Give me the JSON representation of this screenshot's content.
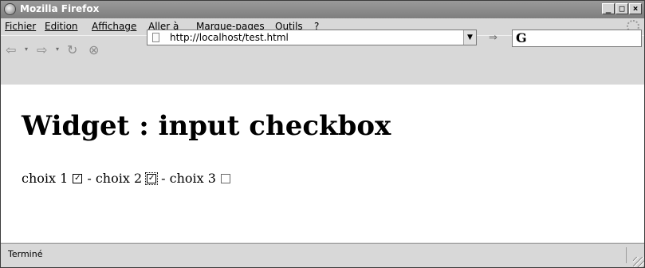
{
  "window": {
    "title": "Mozilla Firefox",
    "controls": [
      "_",
      "□",
      "×"
    ]
  },
  "menubar": {
    "items": [
      {
        "label": "Fichier"
      },
      {
        "label": "Edition"
      },
      {
        "label": "Affichage"
      },
      {
        "label": "Aller à"
      },
      {
        "label": "Marque-pages"
      },
      {
        "label": "Outils"
      },
      {
        "label": "?"
      }
    ]
  },
  "toolbar": {
    "back": "⇦",
    "forward": "⇨",
    "reload": "↻",
    "stop": "⊗",
    "dropdown": "▾",
    "go": "⇒"
  },
  "urlbar": {
    "value": "http://localhost/test.html",
    "dropdown": "▼"
  },
  "searchbar": {
    "engine_glyph": "G",
    "value": ""
  },
  "page": {
    "heading": "Widget : input checkbox",
    "choices": [
      {
        "label": "choix 1",
        "checked": true
      },
      {
        "separator": "-",
        "label": "choix 2",
        "checked": true,
        "focused": true
      },
      {
        "separator": "-",
        "label": "choix 3",
        "checked": false
      }
    ]
  },
  "statusbar": {
    "text": "Terminé"
  }
}
